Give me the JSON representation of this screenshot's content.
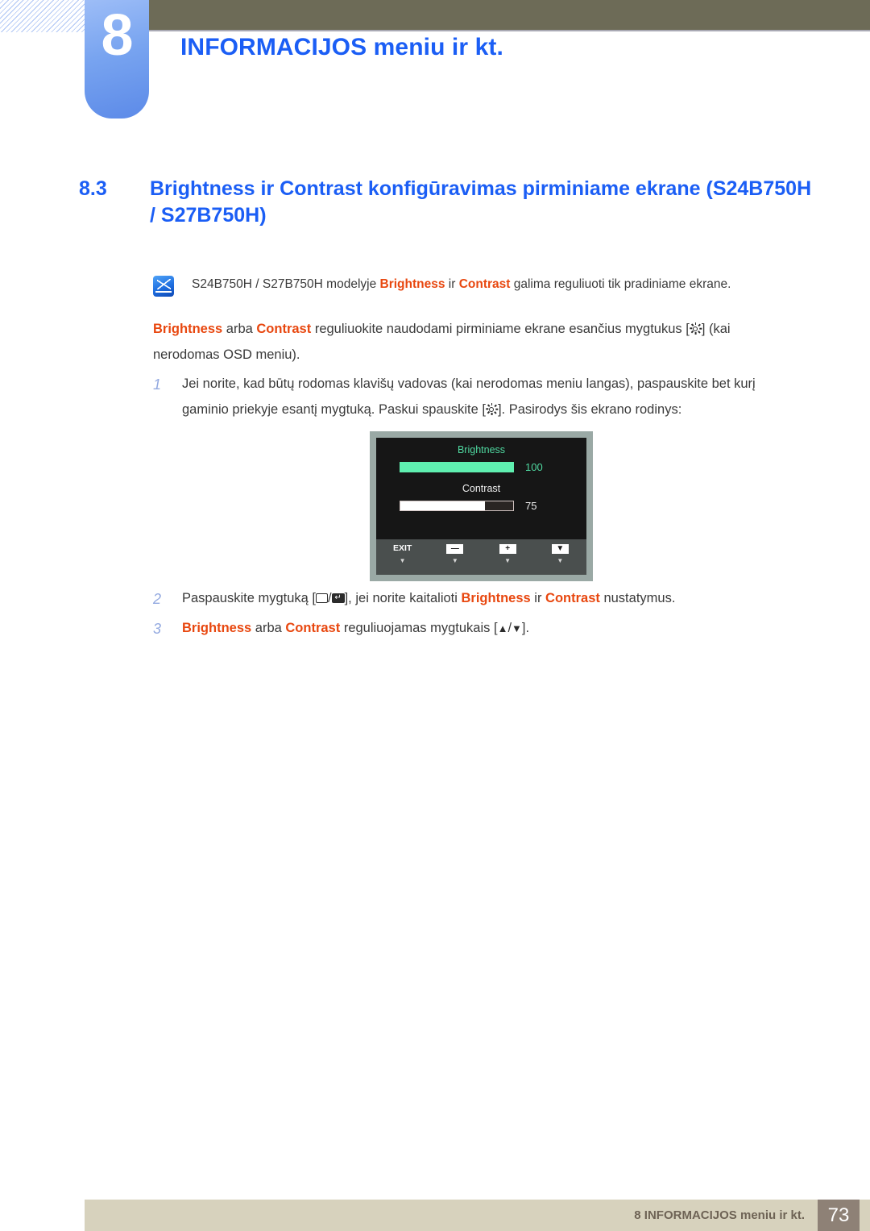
{
  "header": {
    "chapter_number": "8",
    "title": "INFORMACIJOS meniu ir kt.",
    "title_color": "#1b5ef5",
    "bar_color": "#6d6b57",
    "tab_color": "#78a4f0"
  },
  "section": {
    "number": "8.3",
    "title_line1": "Brightness ir Contrast konfigūravimas pirminiame ekrane",
    "title_line2": "(S24B750H / S27B750H)"
  },
  "note": {
    "icon": "note-pen-icon",
    "text_1": "S24B750H / S27B750H modelyje ",
    "kw_1": "Brightness",
    "text_2": " ir ",
    "kw_2": "Contrast",
    "text_3": " galima reguliuoti tik pradiniame ekrane."
  },
  "intro": {
    "kw_1": "Brightness",
    "text_1": " arba ",
    "kw_2": "Contrast",
    "text_2": " reguliuokite naudodami pirminiame ekrane esančius mygtukus [",
    "icon": "brightness-sun-icon",
    "text_3": "] (kai nerodomas OSD meniu)."
  },
  "steps": [
    {
      "number": "1",
      "text_1": "Jei norite, kad būtų rodomas klavišų vadovas (kai nerodomas meniu langas), paspauskite bet kurį gaminio priekyje esantį mygtuką. Paskui spauskite [",
      "icon": "brightness-sun-icon",
      "text_2": "]. Pasirodys šis ekrano rodinys:"
    },
    {
      "number": "2",
      "text_1": "Paspauskite mygtuką [",
      "icon_1": "menu-rect-icon",
      "sep": "/",
      "icon_2": "enter-return-icon",
      "text_2": "], jei norite kaitalioti ",
      "kw_1": "Brightness",
      "text_3": " ir ",
      "kw_2": "Contrast",
      "text_4": " nustatymus."
    },
    {
      "number": "3",
      "kw_1": "Brightness",
      "text_1": " arba ",
      "kw_2": "Contrast",
      "text_2": " reguliuojamas mygtukais [",
      "icon_1": "arrow-up-icon",
      "sep": "/",
      "icon_2": "arrow-down-icon",
      "text_3": "]."
    }
  ],
  "osd": {
    "brightness_label": "Brightness",
    "brightness_value": "100",
    "brightness_fill_percent": 100,
    "brightness_color": "#5fefb0",
    "contrast_label": "Contrast",
    "contrast_value": "75",
    "contrast_fill_percent": 75,
    "contrast_color": "#ffffff",
    "screen_bg": "#161616",
    "bezel_color": "#9aa9a5",
    "toolbar_bg": "#4a4f4e",
    "toolbar": [
      {
        "label": "EXIT",
        "type": "text",
        "caret": "▼"
      },
      {
        "label": "—",
        "type": "button",
        "icon": "minus-button-icon",
        "caret": "▼"
      },
      {
        "label": "+",
        "type": "button",
        "icon": "plus-button-icon",
        "caret": "▼"
      },
      {
        "label": "▼",
        "type": "button",
        "icon": "down-button-icon",
        "caret": "▼"
      }
    ]
  },
  "footer": {
    "text": "8 INFORMACIJOS meniu ir kt.",
    "page": "73",
    "bar_color": "#d7d2bd",
    "page_box_color": "#8e8176"
  }
}
